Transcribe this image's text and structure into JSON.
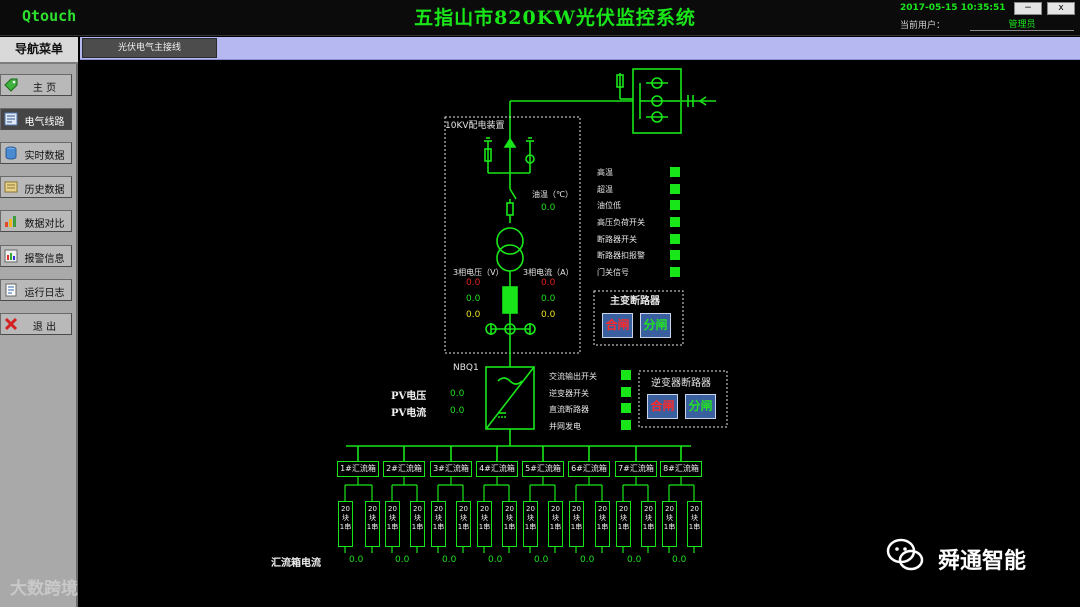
{
  "app": {
    "name": "Qtouch",
    "title": "五指山市820KW光伏监控系统",
    "datetime": "2017-05-15 10:35:51",
    "user_label": "当前用户：",
    "user_name": "管理员",
    "min_label": "−",
    "close_label": "x"
  },
  "sidebar": {
    "header": "导航菜单",
    "items": [
      {
        "label": "主 页",
        "icon": "tag-icon"
      },
      {
        "label": "电气线路",
        "icon": "diagram-icon",
        "active": true
      },
      {
        "label": "实时数据",
        "icon": "database-icon"
      },
      {
        "label": "历史数据",
        "icon": "history-icon"
      },
      {
        "label": "数据对比",
        "icon": "bar-chart-icon"
      },
      {
        "label": "报警信息",
        "icon": "alarm-icon"
      },
      {
        "label": "运行日志",
        "icon": "log-icon"
      },
      {
        "label": "退 出",
        "icon": "exit-icon"
      }
    ]
  },
  "tab": {
    "label": "光伏电气主接线"
  },
  "transformer": {
    "box_title": "10KV配电装置",
    "oil_temp_label": "油温（℃）",
    "oil_temp_value": "0.0",
    "voltage_label": "3相电压（V）",
    "current_label": "3相电流（A）",
    "voltages": [
      "0.0",
      "0.0",
      "0.0"
    ],
    "currents": [
      "0.0",
      "0.0",
      "0.0"
    ]
  },
  "status_signals": [
    {
      "label": "高温"
    },
    {
      "label": "超温"
    },
    {
      "label": "油位低"
    },
    {
      "label": "高压负荷开关"
    },
    {
      "label": "断路器开关"
    },
    {
      "label": "断路器扣报警"
    },
    {
      "label": "门关信号"
    }
  ],
  "main_breaker": {
    "title": "主变断路器",
    "on_label": "合闸",
    "off_label": "分闸"
  },
  "inverter": {
    "name": "NBQ1",
    "pv_voltage_label": "PV电压",
    "pv_voltage_value": "0.0",
    "pv_current_label": "PV电流",
    "pv_current_value": "0.0",
    "signals": [
      {
        "label": "交流输出开关"
      },
      {
        "label": "逆变器开关"
      },
      {
        "label": "直流断路器"
      },
      {
        "label": "并网发电"
      }
    ]
  },
  "inverter_breaker": {
    "title": "逆变器断路器",
    "on_label": "合闸",
    "off_label": "分闸"
  },
  "combiner_boxes": [
    {
      "label": "1#汇流箱",
      "current": "0.0"
    },
    {
      "label": "2#汇流箱",
      "current": "0.0"
    },
    {
      "label": "3#汇流箱",
      "current": "0.0"
    },
    {
      "label": "4#汇流箱",
      "current": "0.0"
    },
    {
      "label": "5#汇流箱",
      "current": "0.0"
    },
    {
      "label": "6#汇流箱",
      "current": "0.0"
    },
    {
      "label": "7#汇流箱",
      "current": "0.0"
    },
    {
      "label": "8#汇流箱",
      "current": "0.0"
    }
  ],
  "combiner_current_label": "汇流箱电流",
  "string_label": "20块1串",
  "colors": {
    "line": "#19e619",
    "on": "#ff2a2a",
    "off": "#22e322",
    "tabbar": "#b6b8f2"
  },
  "watermarks": {
    "brand": "舜通智能",
    "corner": "大数跨境"
  }
}
